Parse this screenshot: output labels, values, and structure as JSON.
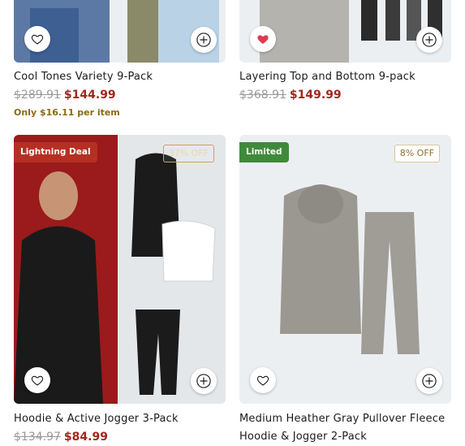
{
  "products": [
    {
      "title": "Cool Tones Variety 9-Pack",
      "old_price": "$289.91",
      "new_price": "$144.99",
      "per_item": "Only $16.11 per item"
    },
    {
      "title": "Layering Top and Bottom 9-pack",
      "old_price": "$368.91",
      "new_price": "$149.99"
    },
    {
      "title": "Hoodie & Active Jogger 3-Pack",
      "old_price": "$134.97",
      "new_price": "$84.99",
      "badge": "Lightning Deal",
      "discount": "37% OFF"
    },
    {
      "title_line1": "Medium Heather Gray Pullover Fleece",
      "title_line2": "Hoodie & Jogger 2-Pack",
      "badge": "Limited",
      "discount": "8% OFF"
    }
  ],
  "colors": {
    "sale_red": "#a3261d",
    "wishlist_active": "#e03a4f",
    "badge_red": "#b53023",
    "badge_green": "#3f8a3a"
  },
  "icons": [
    "heart-icon",
    "heart-filled-icon",
    "plus-icon"
  ]
}
